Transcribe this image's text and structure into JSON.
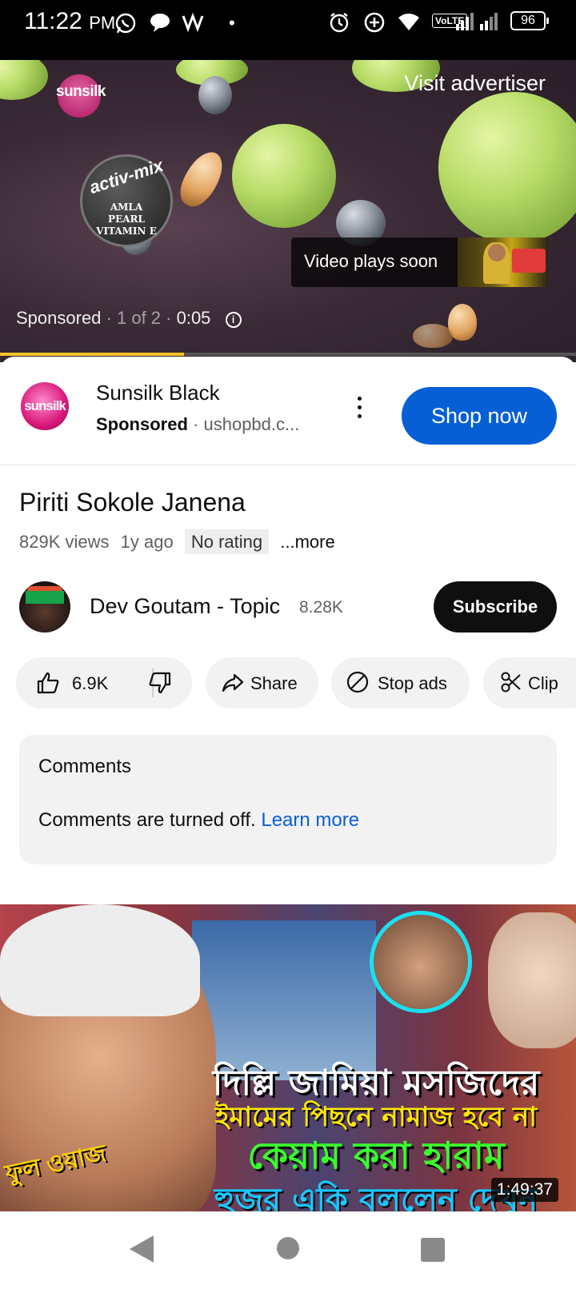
{
  "status_bar": {
    "time": "11:22",
    "ampm": "PM",
    "network_label": "VoLTE",
    "battery": "96"
  },
  "ad_video": {
    "brand": "sunsilk",
    "badge_top": "activ-mix",
    "badge_lines": [
      "AMLA",
      "PEARL",
      "VITAMIN E"
    ],
    "visit_advertiser": "Visit advertiser",
    "video_plays_soon": "Video plays soon",
    "sponsored": "Sponsored",
    "ad_count": "· 1 of 2 ·",
    "time_left": "0:05",
    "progress": 0.32
  },
  "ad_card": {
    "avatar_text": "sunsilk",
    "title": "Sunsilk Black",
    "sponsored": "Sponsored",
    "separator": "·",
    "domain": "ushopbd.c...",
    "cta": "Shop now"
  },
  "video": {
    "title": "Piriti Sokole Janena",
    "views": "829K views",
    "age": "1y ago",
    "rating": "No rating",
    "more": "...more"
  },
  "channel": {
    "name": "Dev Goutam - Topic",
    "subscribers": "8.28K",
    "subscribe": "Subscribe"
  },
  "actions": {
    "likes": "6.9K",
    "share": "Share",
    "stop_ads": "Stop ads",
    "clip": "Clip"
  },
  "comments": {
    "title": "Comments",
    "text": "Comments are turned off.",
    "link": "Learn more"
  },
  "next_video": {
    "line1": "দিল্লি জামিয়া মসজিদের",
    "line2": "ইমামের পিছনে নামাজ হবে না",
    "line3": "কেয়াম করা হারাম",
    "line4": "হুজুর একি বললেন দেখুন",
    "tag": "ফুল ওয়াজ",
    "duration": "1:49:37"
  },
  "colors": {
    "accent_blue": "#065fd4",
    "ad_progress": "#f7c325",
    "dark_button": "#0f0f0f"
  }
}
